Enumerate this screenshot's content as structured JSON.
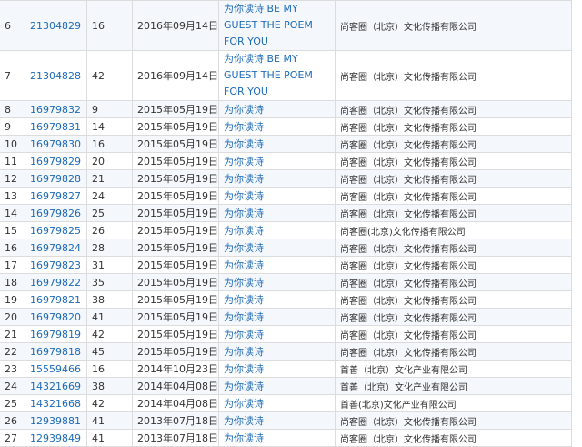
{
  "rows": [
    {
      "idx": "6",
      "reg": "21304829",
      "cls": "16",
      "date": "2016年09月14日",
      "name": "为你读诗 BE MY GUEST THE POEM FOR YOU",
      "owner": "尚客圈（北京）文化传播有限公司"
    },
    {
      "idx": "7",
      "reg": "21304828",
      "cls": "42",
      "date": "2016年09月14日",
      "name": "为你读诗 BE MY GUEST THE POEM FOR YOU",
      "owner": "尚客圈（北京）文化传播有限公司"
    },
    {
      "idx": "8",
      "reg": "16979832",
      "cls": "9",
      "date": "2015年05月19日",
      "name": "为你读诗",
      "owner": "尚客圈（北京）文化传播有限公司"
    },
    {
      "idx": "9",
      "reg": "16979831",
      "cls": "14",
      "date": "2015年05月19日",
      "name": "为你读诗",
      "owner": "尚客圈（北京）文化传播有限公司"
    },
    {
      "idx": "10",
      "reg": "16979830",
      "cls": "16",
      "date": "2015年05月19日",
      "name": "为你读诗",
      "owner": "尚客圈（北京）文化传播有限公司"
    },
    {
      "idx": "11",
      "reg": "16979829",
      "cls": "20",
      "date": "2015年05月19日",
      "name": "为你读诗",
      "owner": "尚客圈（北京）文化传播有限公司"
    },
    {
      "idx": "12",
      "reg": "16979828",
      "cls": "21",
      "date": "2015年05月19日",
      "name": "为你读诗",
      "owner": "尚客圈（北京）文化传播有限公司"
    },
    {
      "idx": "13",
      "reg": "16979827",
      "cls": "24",
      "date": "2015年05月19日",
      "name": "为你读诗",
      "owner": "尚客圈（北京）文化传播有限公司"
    },
    {
      "idx": "14",
      "reg": "16979826",
      "cls": "25",
      "date": "2015年05月19日",
      "name": "为你读诗",
      "owner": "尚客圈（北京）文化传播有限公司"
    },
    {
      "idx": "15",
      "reg": "16979825",
      "cls": "26",
      "date": "2015年05月19日",
      "name": "为你读诗",
      "owner": "尚客圈(北京)文化传播有限公司"
    },
    {
      "idx": "16",
      "reg": "16979824",
      "cls": "28",
      "date": "2015年05月19日",
      "name": "为你读诗",
      "owner": "尚客圈（北京）文化传播有限公司"
    },
    {
      "idx": "17",
      "reg": "16979823",
      "cls": "31",
      "date": "2015年05月19日",
      "name": "为你读诗",
      "owner": "尚客圈（北京）文化传播有限公司"
    },
    {
      "idx": "18",
      "reg": "16979822",
      "cls": "35",
      "date": "2015年05月19日",
      "name": "为你读诗",
      "owner": "尚客圈（北京）文化传播有限公司"
    },
    {
      "idx": "19",
      "reg": "16979821",
      "cls": "38",
      "date": "2015年05月19日",
      "name": "为你读诗",
      "owner": "尚客圈（北京）文化传播有限公司"
    },
    {
      "idx": "20",
      "reg": "16979820",
      "cls": "41",
      "date": "2015年05月19日",
      "name": "为你读诗",
      "owner": "尚客圈（北京）文化传播有限公司"
    },
    {
      "idx": "21",
      "reg": "16979819",
      "cls": "42",
      "date": "2015年05月19日",
      "name": "为你读诗",
      "owner": "尚客圈（北京）文化传播有限公司"
    },
    {
      "idx": "22",
      "reg": "16979818",
      "cls": "45",
      "date": "2015年05月19日",
      "name": "为你读诗",
      "owner": "尚客圈（北京）文化传播有限公司"
    },
    {
      "idx": "23",
      "reg": "15559466",
      "cls": "16",
      "date": "2014年10月23日",
      "name": "为你读诗",
      "owner": "首善（北京）文化产业有限公司"
    },
    {
      "idx": "24",
      "reg": "14321669",
      "cls": "38",
      "date": "2014年04月08日",
      "name": "为你读诗",
      "owner": "首善（北京）文化产业有限公司"
    },
    {
      "idx": "25",
      "reg": "14321668",
      "cls": "42",
      "date": "2014年04月08日",
      "name": "为你读诗",
      "owner": "首善(北京)文化产业有限公司"
    },
    {
      "idx": "26",
      "reg": "12939881",
      "cls": "41",
      "date": "2013年07月18日",
      "name": "为你读诗",
      "owner": "尚客圈（北京）文化传播有限公司"
    },
    {
      "idx": "27",
      "reg": "12939849",
      "cls": "41",
      "date": "2013年07月18日",
      "name": "为你读诗",
      "owner": "尚客圈（北京）文化传播有限公司"
    }
  ]
}
